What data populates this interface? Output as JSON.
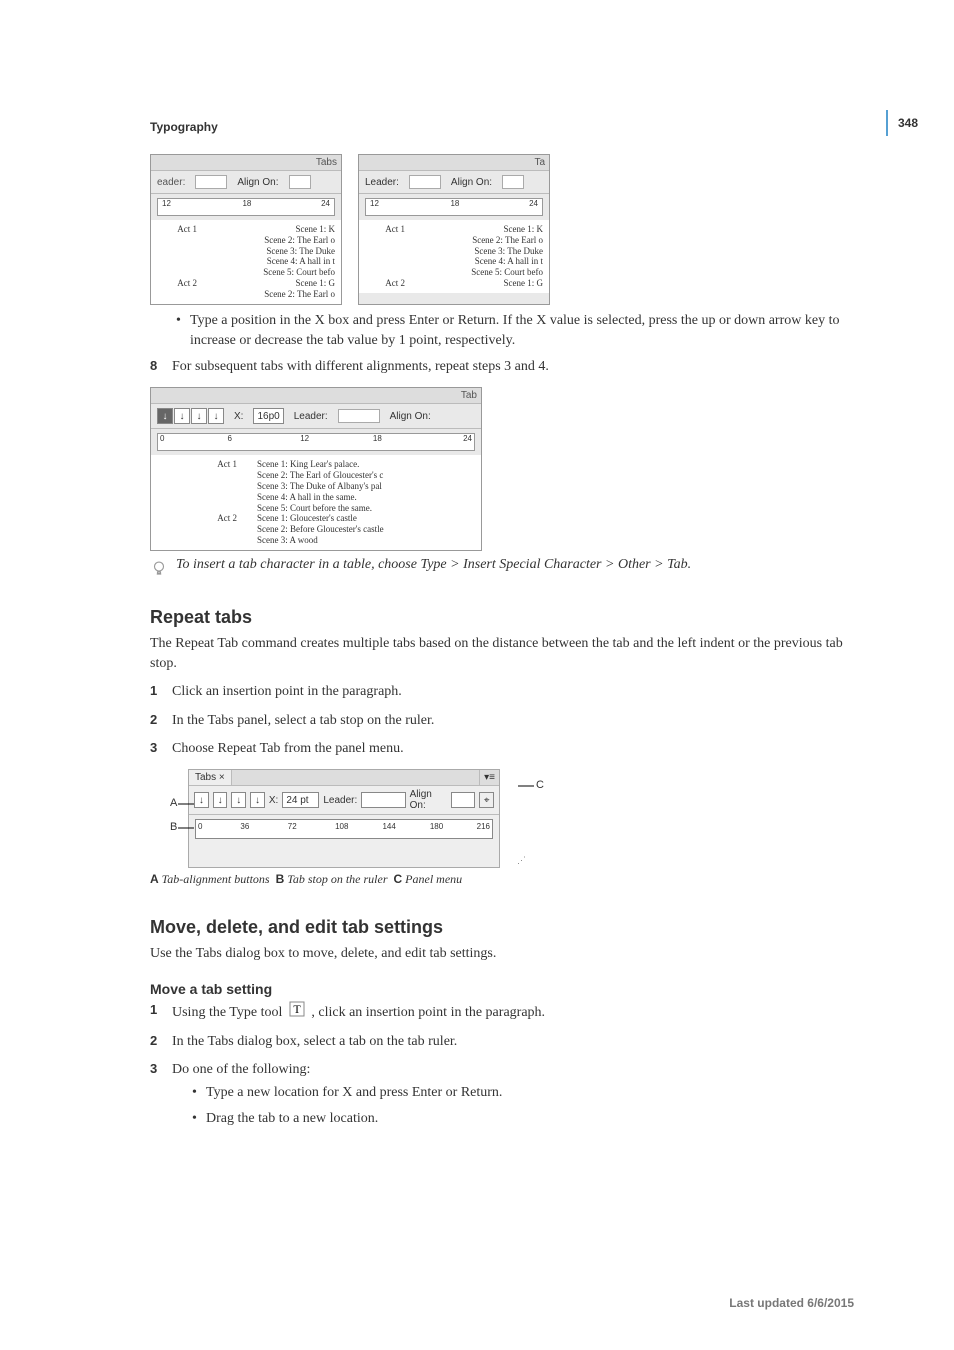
{
  "page_number": "348",
  "header": "Typography",
  "fig1": {
    "panel_title": "Tabs",
    "leader_label": "Leader:",
    "align_label": "Align On:",
    "ruler_numbers": [
      "12",
      "18",
      "24"
    ],
    "acts": {
      "act1_label": "Act 1",
      "act2_label": "Act 2",
      "scenes_a": [
        "Scene 1: K",
        "Scene 2: The Earl o",
        "Scene 3: The Duke",
        "Scene 4: A hall in t",
        "Scene 5: Court befo"
      ],
      "scenes_b": [
        "Scene 1: G",
        "Scene 2: The Earl o"
      ]
    }
  },
  "bullet1": "Type a position in the X box and press Enter or Return. If the X value is selected, press the up or down arrow key to increase or decrease the tab value by 1 point, respectively.",
  "step8": "For subsequent tabs with different alignments, repeat steps 3 and 4.",
  "fig2": {
    "panel_title": "Tab",
    "x_label": "X:",
    "x_value": "16p0",
    "leader_label": "Leader:",
    "align_label": "Align On:",
    "ruler_numbers": [
      "0",
      "6",
      "12",
      "18",
      "24"
    ],
    "act1_label": "Act 1",
    "act2_label": "Act 2",
    "act1_scenes": [
      "Scene 1: King Lear's palace.",
      "Scene 2: The Earl of Gloucester's c",
      "Scene 3: The Duke of Albany's pal",
      "Scene 4: A hall in the same.",
      "Scene 5: Court before the same."
    ],
    "act2_scenes": [
      "Scene 1: Gloucester's castle",
      "Scene 2: Before Gloucester's castle",
      "Scene 3: A wood"
    ]
  },
  "tip": "To insert a tab character in a table, choose Type > Insert Special Character > Other > Tab.",
  "section_repeat": {
    "heading": "Repeat tabs",
    "intro": "The Repeat Tab command creates multiple tabs based on the distance between the tab and the left indent or the previous tab stop.",
    "steps": {
      "s1": "Click an insertion point in the paragraph.",
      "s2": "In the Tabs panel, select a tab stop on the ruler.",
      "s3": "Choose Repeat Tab from the panel menu."
    }
  },
  "fig3": {
    "tab_label": "Tabs",
    "x_label": "X:",
    "x_value": "24 pt",
    "leader_label": "Leader:",
    "align_label": "Align On:",
    "ruler_numbers": [
      "0",
      "36",
      "72",
      "108",
      "144",
      "180",
      "216"
    ],
    "callout_A": "A",
    "callout_B": "B",
    "callout_C": "C",
    "caption_A": "Tab-alignment buttons",
    "caption_B": "Tab stop on the ruler",
    "caption_C": "Panel menu"
  },
  "section_move": {
    "heading": "Move, delete, and edit tab settings",
    "intro": "Use the Tabs dialog box to move, delete, and edit tab settings.",
    "sub_heading": "Move a tab setting",
    "steps": {
      "s1a": "Using the Type tool ",
      "s1b": " , click an insertion point in the paragraph.",
      "s2": "In the Tabs dialog box, select a tab on the tab ruler.",
      "s3": "Do one of the following:",
      "sub1": "Type a new location for X and press Enter or Return.",
      "sub2": "Drag the tab to a new location."
    }
  },
  "footer": "Last updated 6/6/2015"
}
